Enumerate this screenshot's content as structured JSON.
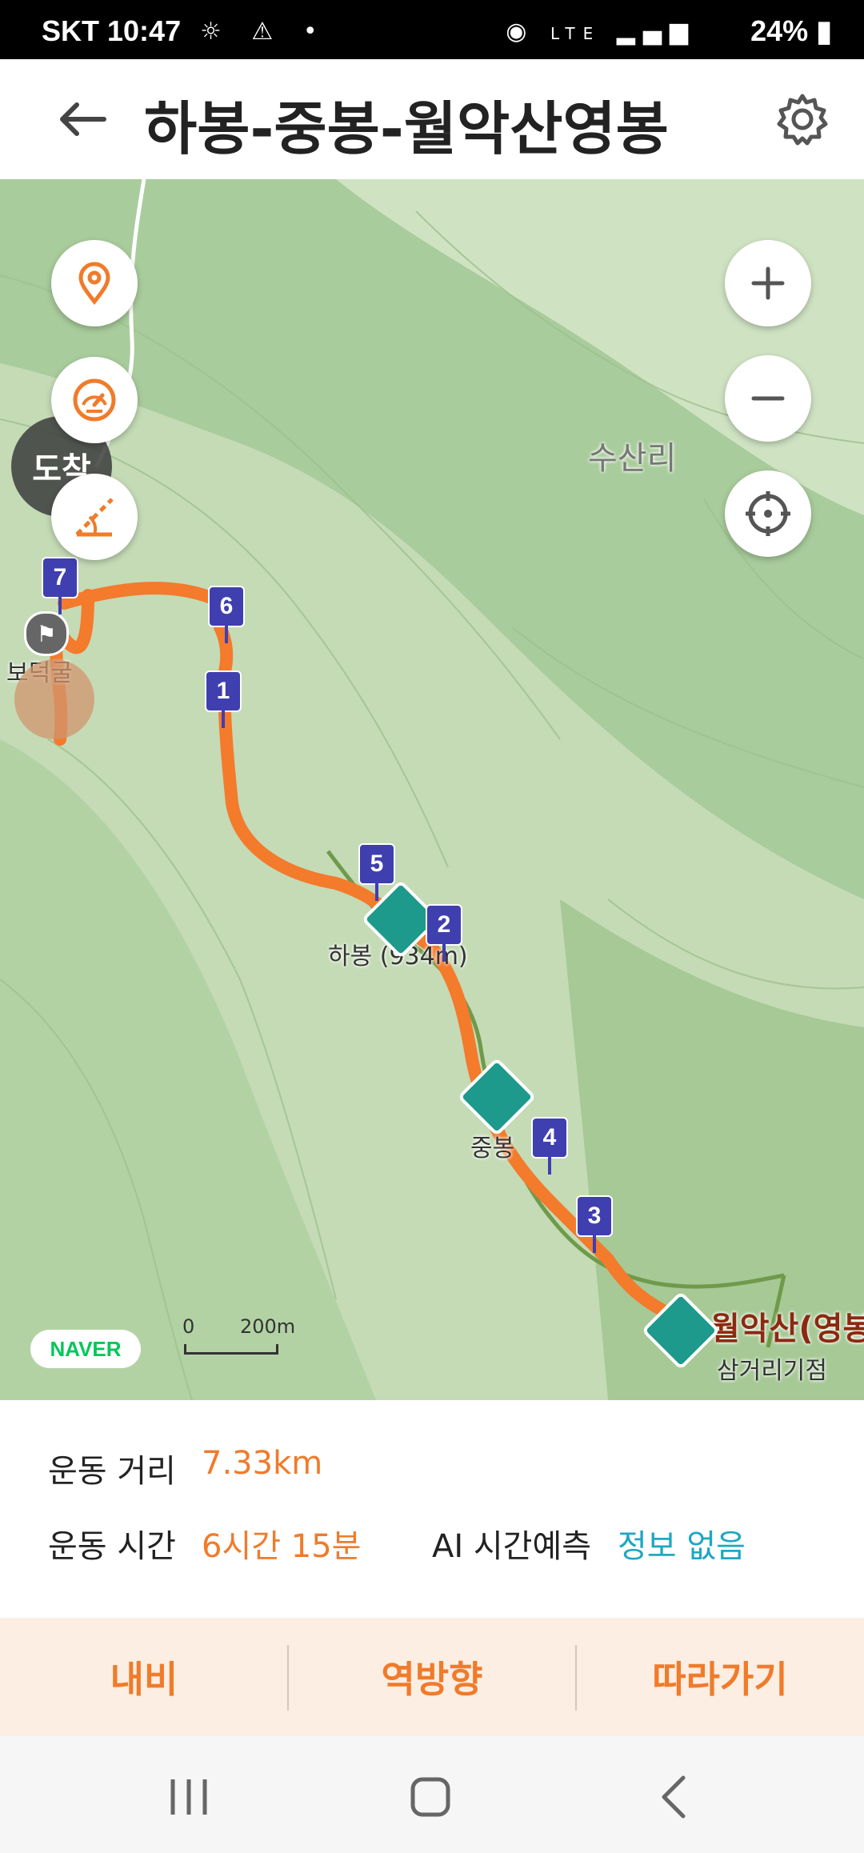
{
  "status_bar": {
    "carrier": "SKT",
    "time": "10:47",
    "network": "LTE",
    "battery": "24%"
  },
  "header": {
    "title": "하봉-중봉-월악산영봉"
  },
  "map": {
    "labels": {
      "village": "수산리",
      "cave": "보덕굴",
      "peak_habong": "하봉 (934m)",
      "peak_jungbong": "중봉",
      "peak_yeongbong": "월악산(영봉",
      "junction": "삼거리기점"
    },
    "markers": [
      "1",
      "2",
      "3",
      "4",
      "5",
      "6",
      "7"
    ],
    "arrive_badge": "도착",
    "naver_logo": "NAVER",
    "scale": {
      "zero": "0",
      "distance": "200m"
    },
    "route_color": "#f47a2c",
    "trail_color": "#6f9a4a"
  },
  "info": {
    "distance_label": "운동 거리",
    "distance_value": "7.33km",
    "time_label": "운동 시간",
    "time_value": "6시간 15분",
    "ai_label": "AI 시간예측",
    "ai_value": "정보 없음"
  },
  "actions": {
    "navi": "내비",
    "reverse": "역방향",
    "follow": "따라가기"
  },
  "colors": {
    "accent": "#f07b2a",
    "marker": "#3f3fb0",
    "peak": "#1e9a8c",
    "ai_value": "#1fa7c2"
  }
}
